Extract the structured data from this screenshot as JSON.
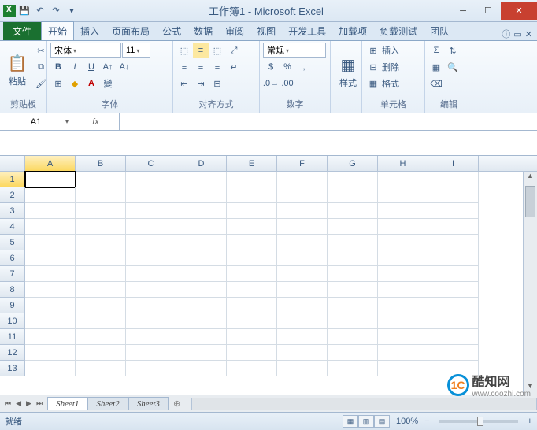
{
  "title": "工作簿1 - Microsoft Excel",
  "qat": {
    "save": "💾",
    "undo": "↶",
    "redo": "↷"
  },
  "tabs": {
    "file": "文件",
    "items": [
      "开始",
      "插入",
      "页面布局",
      "公式",
      "数据",
      "审阅",
      "视图",
      "开发工具",
      "加载项",
      "负载测试",
      "团队"
    ],
    "active": 0
  },
  "ribbon": {
    "clipboard": {
      "paste": "粘贴",
      "label": "剪贴板"
    },
    "font": {
      "name": "宋体",
      "size": "11",
      "bold": "B",
      "italic": "I",
      "underline": "U",
      "label": "字体"
    },
    "align": {
      "label": "对齐方式"
    },
    "number": {
      "format": "常规",
      "label": "数字"
    },
    "styles": {
      "btn": "样式",
      "label": ""
    },
    "cells": {
      "insert": "插入",
      "delete": "删除",
      "format": "格式",
      "label": "单元格"
    },
    "editing": {
      "label": "编辑"
    }
  },
  "namebox": "A1",
  "fx": "fx",
  "columns": [
    "A",
    "B",
    "C",
    "D",
    "E",
    "F",
    "G",
    "H",
    "I"
  ],
  "rows": [
    "1",
    "2",
    "3",
    "4",
    "5",
    "6",
    "7",
    "8",
    "9",
    "10",
    "11",
    "12",
    "13"
  ],
  "activeCell": {
    "row": 0,
    "col": 0
  },
  "sheets": [
    "Sheet1",
    "Sheet2",
    "Sheet3"
  ],
  "activeSheet": 0,
  "status": {
    "ready": "就绪",
    "zoom": "100%"
  },
  "watermark": {
    "text": "酷知网",
    "url": "www.coozhi.com"
  }
}
